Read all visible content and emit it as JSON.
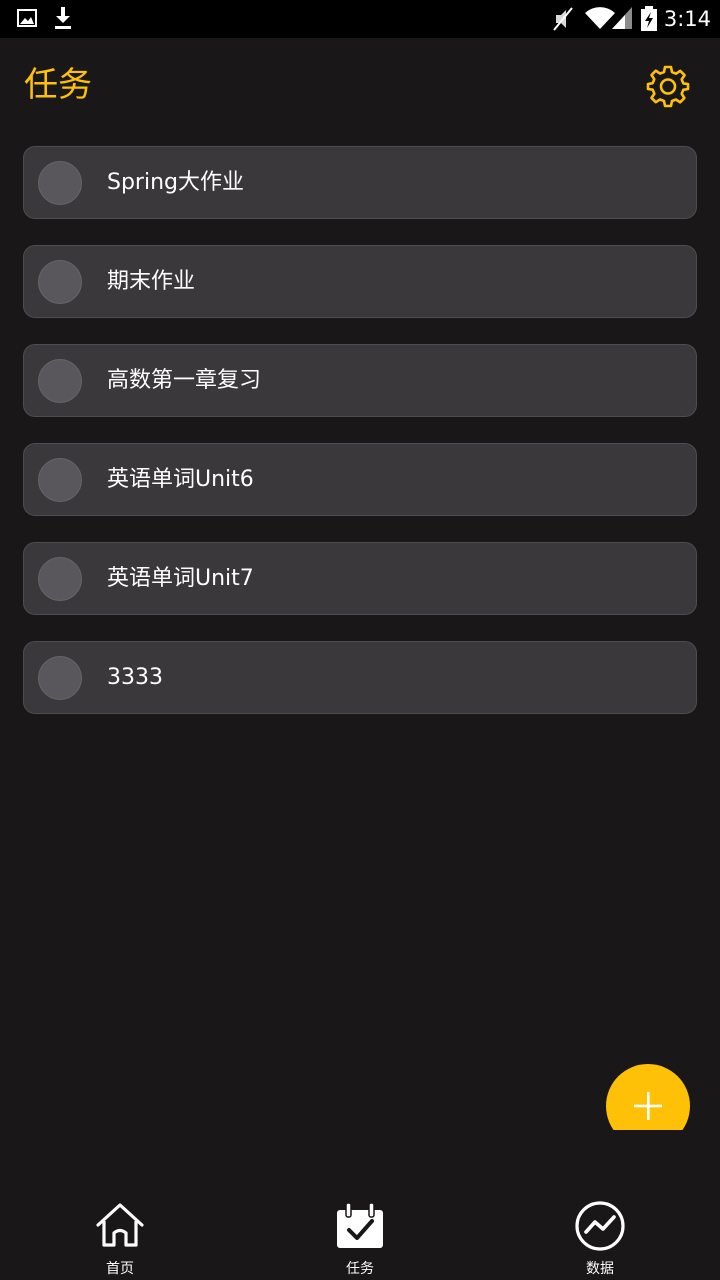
{
  "status_bar": {
    "time": "3:14",
    "icons": [
      "image-icon",
      "download-icon",
      "mute-icon",
      "wifi-icon",
      "signal-icon",
      "battery-charging-icon"
    ]
  },
  "header": {
    "title": "任务",
    "settings_icon": "gear-icon"
  },
  "tasks": [
    {
      "label": "Spring大作业",
      "done": false
    },
    {
      "label": "期末作业",
      "done": false
    },
    {
      "label": "高数第一章复习",
      "done": false
    },
    {
      "label": "英语单词Unit6",
      "done": false
    },
    {
      "label": "英语单词Unit7",
      "done": false
    },
    {
      "label": "3333",
      "done": false
    }
  ],
  "fab": {
    "icon": "plus-icon"
  },
  "bottom_nav": {
    "items": [
      {
        "label": "首页",
        "icon": "home-icon"
      },
      {
        "label": "任务",
        "icon": "calendar-check-icon"
      },
      {
        "label": "数据",
        "icon": "trend-chart-icon"
      }
    ]
  },
  "colors": {
    "background": "#1a1719",
    "accent": "#ffc107",
    "card": "#3b383c",
    "check_circle": "#5a575c",
    "text": "#ffffff"
  }
}
